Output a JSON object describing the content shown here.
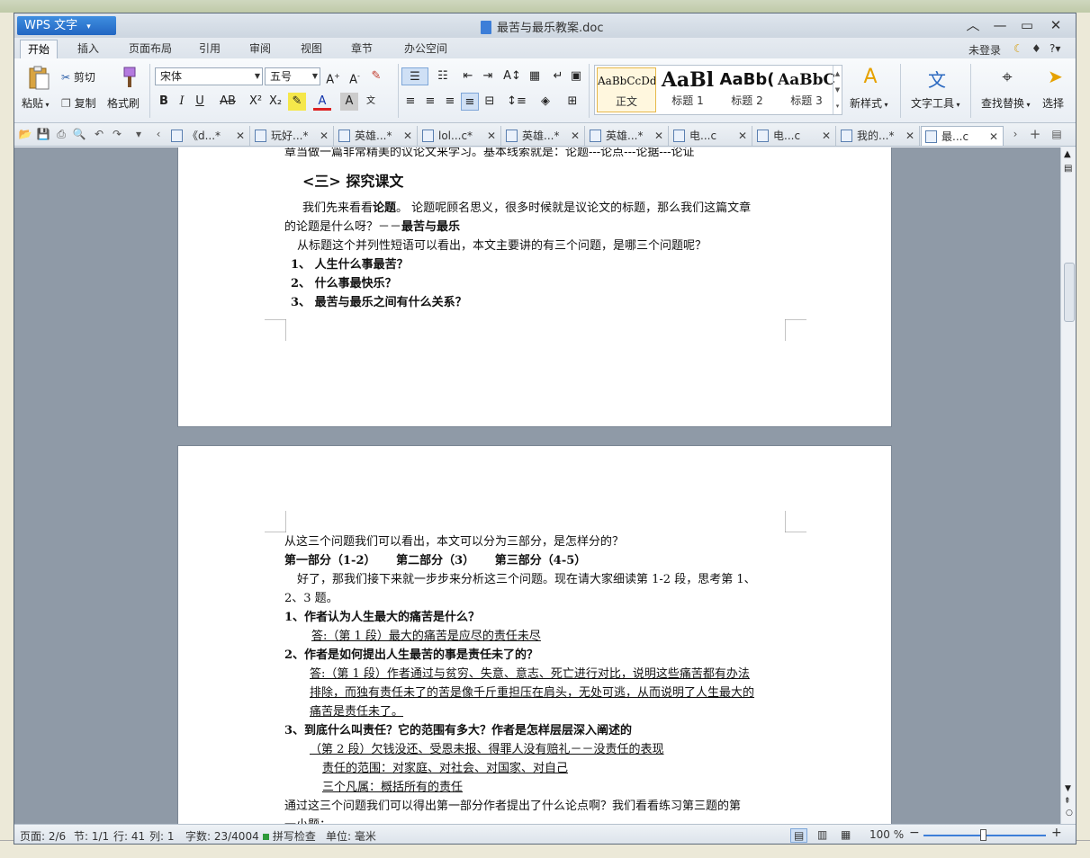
{
  "app": {
    "name": "WPS 文字",
    "doc_title": "最苦与最乐教案.doc",
    "login": "未登录"
  },
  "menu_tabs": [
    "开始",
    "插入",
    "页面布局",
    "引用",
    "审阅",
    "视图",
    "章节",
    "办公空间"
  ],
  "ribbon": {
    "paste": "粘贴",
    "cut": "剪切",
    "copy": "复制",
    "format_painter": "格式刷",
    "font": "宋体",
    "size": "五号",
    "styles": [
      {
        "preview": "AaBbCcDd",
        "label": "正文"
      },
      {
        "preview": "AaBl",
        "label": "标题 1"
      },
      {
        "preview": "AaBb(",
        "label": "标题 2"
      },
      {
        "preview": "AaBbC",
        "label": "标题 3"
      }
    ],
    "new_style": "新样式",
    "text_tools": "文字工具",
    "find_replace": "查找替换",
    "select": "选择"
  },
  "doc_tabs": [
    {
      "label": "《d...*",
      "active": false
    },
    {
      "label": "玩好...*",
      "active": false
    },
    {
      "label": "英雄...*",
      "active": false
    },
    {
      "label": "lol...c*",
      "active": false
    },
    {
      "label": "英雄...*",
      "active": false
    },
    {
      "label": "英雄...*",
      "active": false
    },
    {
      "label": "电...c",
      "active": false
    },
    {
      "label": "电...c",
      "active": false
    },
    {
      "label": "我的...*",
      "active": false
    },
    {
      "label": "最...c",
      "active": true
    }
  ],
  "page1": {
    "top_line": "章当做一篇非常精美的议论文来学习。基本线索就是：论题---论点---论据---论证",
    "heading": "<三> 探究课文",
    "p1_a": "我们先来看看",
    "p1_b": "论题",
    "p1_c": "。 论题呢顾名思义，很多时候就是议论文的标题，那么我们这篇文章",
    "p2_a": "的论题是什么呀？－－",
    "p2_b": "最苦与最乐",
    "p3": "从标题这个并列性短语可以看出，本文主要讲的有三个问题，是哪三个问题呢？",
    "q1": "1、 人生什么事最苦？",
    "q2": "2、 什么事最快乐？",
    "q3": "3、 最苦与最乐之间有什么关系？"
  },
  "page2": {
    "l1": "从这三个问题我们可以看出，本文可以分为三部分，是怎样分的？",
    "l2": "第一部分（1-2）     第二部分（3）     第三部分（4-5）",
    "l3": "好了，那我们接下来就一步步来分析这三个问题。现在请大家细读第 1-2 段，思考第 1、",
    "l4": "2、3 题。",
    "l5": "1、作者认为人生最大的痛苦是什么？",
    "l6": "答:（第 1 段）最大的痛苦是应尽的责任未尽",
    "l7": "2、作者是如何提出人生最苦的事是责任未了的？",
    "l8": "答:（第 1 段）作者通过与贫穷、失意、意志、死亡进行对比，说明这些痛苦都有办法",
    "l9": "排除，而独有责任未了的苦是像千斤重担压在肩头，无处可逃，从而说明了人生最大的",
    "l10": "痛苦是责任未了。",
    "l11": "3、到底什么叫责任？它的范围有多大？作者是怎样层层深入阐述的",
    "l12": "（第 2 段）欠钱没还、受恩未报、得罪人没有赔礼－－没责任的表现",
    "l13": "责任的范围：对家庭、对社会、对国家、对自己",
    "l14": "三个凡属：概括所有的责任",
    "l15": "通过这三个问题我们可以得出第一部分作者提出了什么论点啊？我们看看练习第三题的第",
    "l16": "一小题："
  },
  "status": {
    "page": "页面: 2/6",
    "section": "节: 1/1",
    "row": "行: 41",
    "col": "列: 1",
    "words": "字数: 23/4004",
    "spell": "拼写检查",
    "unit": "单位: 毫米",
    "zoom": "100 %"
  }
}
